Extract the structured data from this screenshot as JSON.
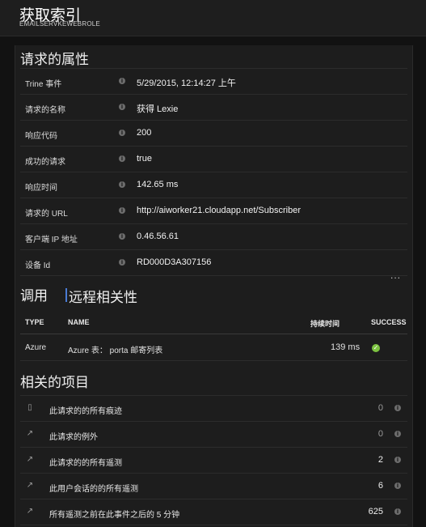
{
  "header": {
    "title": "获取索引",
    "subtitle": "EMAILSERVKEWEBROLE"
  },
  "properties": {
    "title": "请求的属性",
    "rows": [
      {
        "label": "Trine 事件",
        "value": "5/29/2015, 12:14:27 上午"
      },
      {
        "label": "请求的名称",
        "value": "获得 Lexie"
      },
      {
        "label": "响应代码",
        "value": "200"
      },
      {
        "label": "成功的请求",
        "value": "true"
      },
      {
        "label": "响应时间",
        "value": "142.65 ms"
      },
      {
        "label": "请求的 URL",
        "value": "http://aiworker21.cloudapp.net/Subscriber"
      },
      {
        "label": "客户端 IP 地址",
        "value": "0.46.56.61"
      },
      {
        "label": "设备 Id",
        "value": "RD000D3A307156"
      }
    ],
    "more_label": "..."
  },
  "calls": {
    "title": "调用",
    "remote_title": "远程相关性",
    "headers": {
      "type": "TYPE",
      "name": "NAME",
      "duration": "持续时间",
      "success": "SUCCESS"
    },
    "rows": [
      {
        "type": "Azure",
        "name": "Azure 表： porta 邮寄列表",
        "duration": "139 ms"
      }
    ]
  },
  "related": {
    "title": "相关的项目",
    "items": [
      {
        "icon": "trace-icon",
        "label": "此请求的的所有痕迹",
        "count": "0"
      },
      {
        "icon": "exception-icon",
        "label": "此请求的例外",
        "count": "0"
      },
      {
        "icon": "telemetry-icon",
        "label": "此请求的的所有遥测",
        "count": "2"
      },
      {
        "icon": "telemetry-icon",
        "label": "此用户会话的的所有遥测",
        "count": "6"
      },
      {
        "icon": "telemetry-icon",
        "label": "所有遥测之前在此事件之后的 5 分钟",
        "count": "625"
      }
    ]
  },
  "colors": {
    "success": "#7cc240",
    "accent": "#4a7bd4",
    "background": "#121212",
    "panel": "#1d1d1d"
  }
}
